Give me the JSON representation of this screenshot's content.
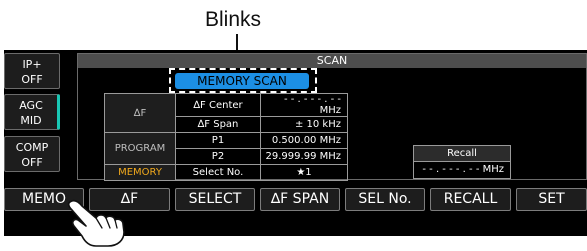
{
  "annotation": {
    "caption": "Blinks"
  },
  "side_buttons": [
    {
      "line1": "IP+",
      "line2": "OFF"
    },
    {
      "line1": "AGC",
      "line2": "MID"
    },
    {
      "line1": "COMP",
      "line2": "OFF"
    }
  ],
  "scan": {
    "title": "SCAN",
    "mode": "MEMORY SCAN",
    "rows": [
      {
        "group": "∆F",
        "name": "∆F Center",
        "value": "- - . - - - . - -  MHz"
      },
      {
        "group": "",
        "name": "∆F Span",
        "value": "±  10  kHz"
      },
      {
        "group": "PROGRAM",
        "name": "P1",
        "value": "0.500.00 MHz"
      },
      {
        "group": "",
        "name": "P2",
        "value": "29.999.99 MHz"
      },
      {
        "group": "MEMORY",
        "name": "Select No.",
        "value": "★1"
      }
    ],
    "recall": {
      "label": "Recall",
      "value": "- - . - - - . - -  MHz"
    }
  },
  "bottom_buttons": [
    "MEMO",
    "∆F",
    "SELECT",
    "∆F SPAN",
    "SEL No.",
    "RECALL",
    "SET"
  ],
  "colors": {
    "accent_blue": "#1c8fe4",
    "memory_orange": "#f0a81c",
    "agc_teal": "#19c7b4"
  }
}
